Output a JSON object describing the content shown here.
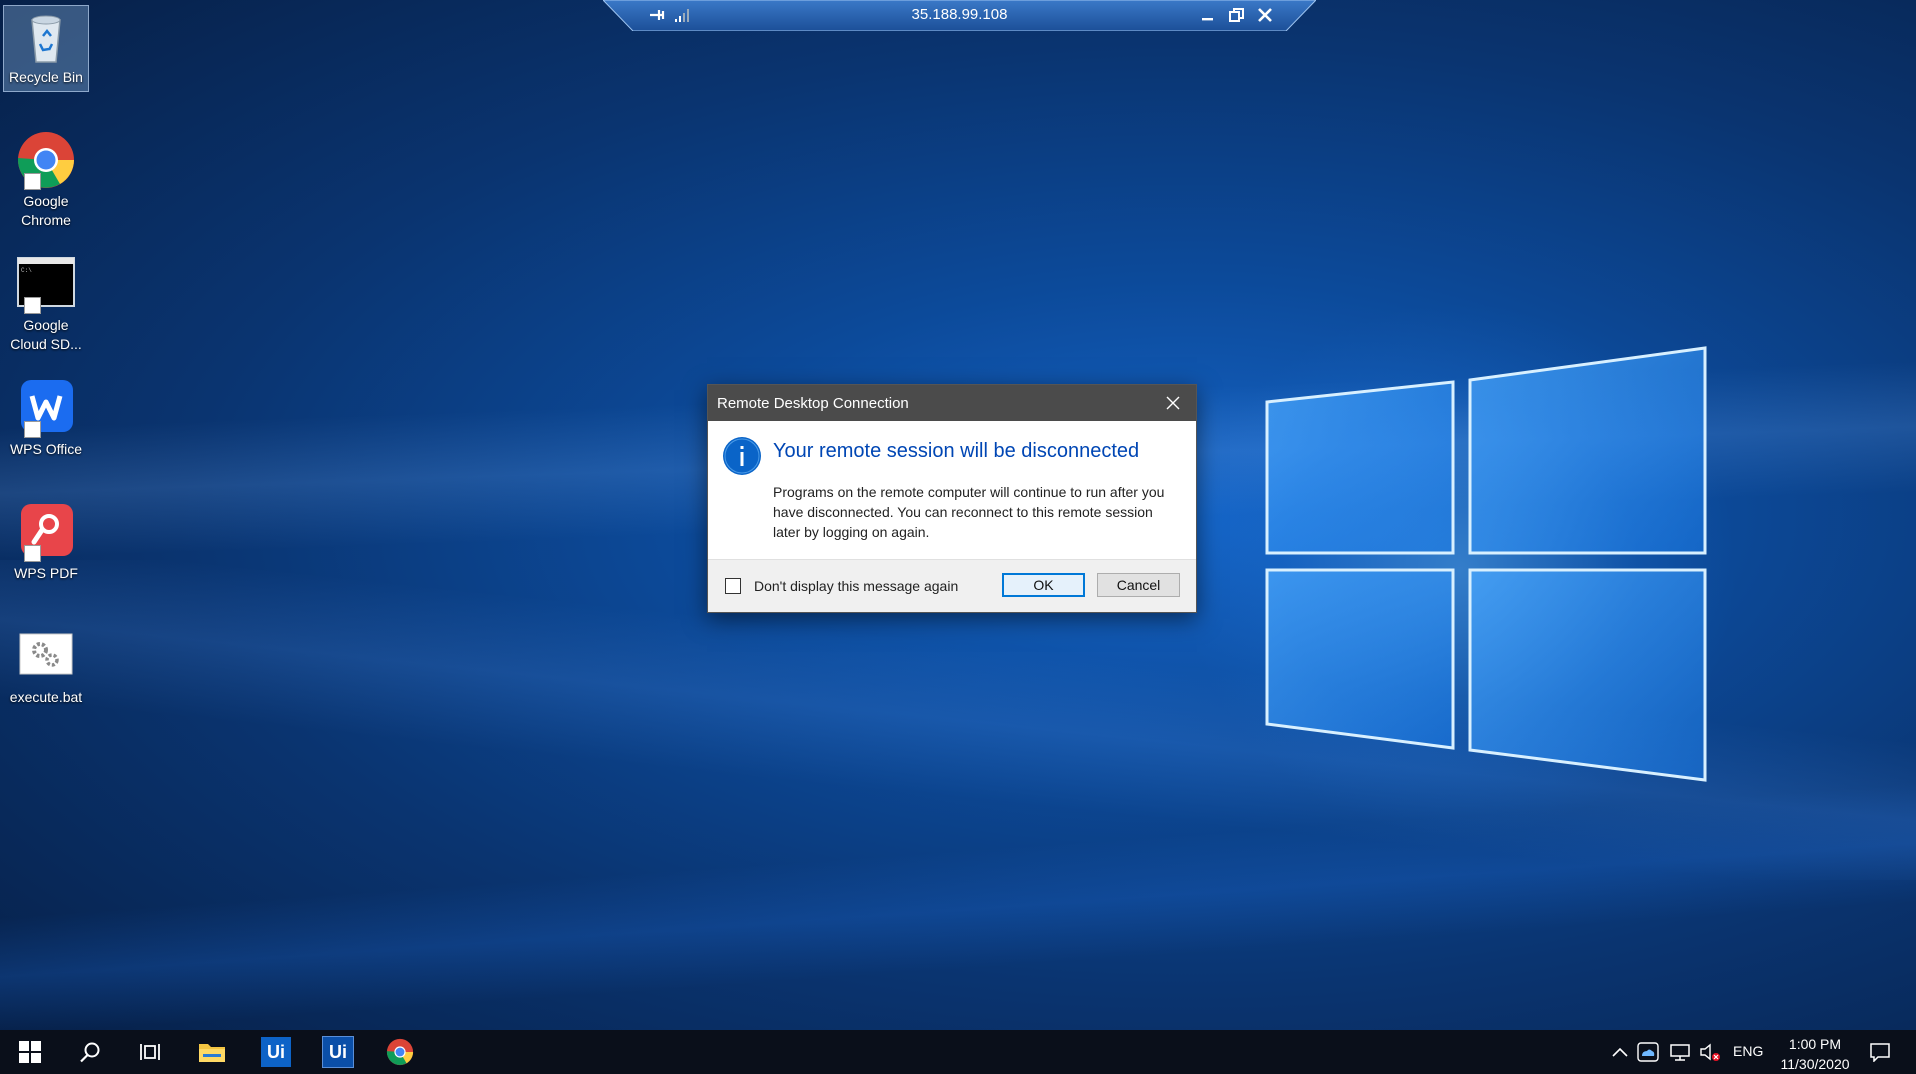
{
  "rdp_bar": {
    "title": "35.188.99.108"
  },
  "desktop_icons": [
    {
      "label": "Recycle Bin"
    },
    {
      "label": "Google Chrome"
    },
    {
      "label": "Google Cloud SD..."
    },
    {
      "label": "WPS Office"
    },
    {
      "label": "WPS PDF"
    },
    {
      "label": "execute.bat"
    }
  ],
  "dialog": {
    "title": "Remote Desktop Connection",
    "heading": "Your remote session will be disconnected",
    "body": "Programs on the remote computer will continue to run after you have disconnected. You can reconnect to this remote session later by logging on again.",
    "checkbox_label": "Don't display this message again",
    "checkbox_checked": false,
    "ok_label": "OK",
    "cancel_label": "Cancel"
  },
  "taskbar": {
    "apps": [
      {
        "icon": "start-icon"
      },
      {
        "icon": "search-icon"
      },
      {
        "icon": "task-view-icon"
      },
      {
        "icon": "file-explorer-icon"
      },
      {
        "icon": "uipath-icon",
        "label": "Ui"
      },
      {
        "icon": "uipath-icon",
        "label": "Ui"
      },
      {
        "icon": "chrome-icon"
      }
    ],
    "tray": {
      "language": "ENG",
      "time": "1:00 PM",
      "date": "11/30/2020"
    }
  },
  "colors": {
    "dialog_heading": "#0046b4",
    "dialog_titlebar": "#4b4b4b",
    "taskbar": "#0a0f1a",
    "uipath_blue": "#0d63c7"
  }
}
